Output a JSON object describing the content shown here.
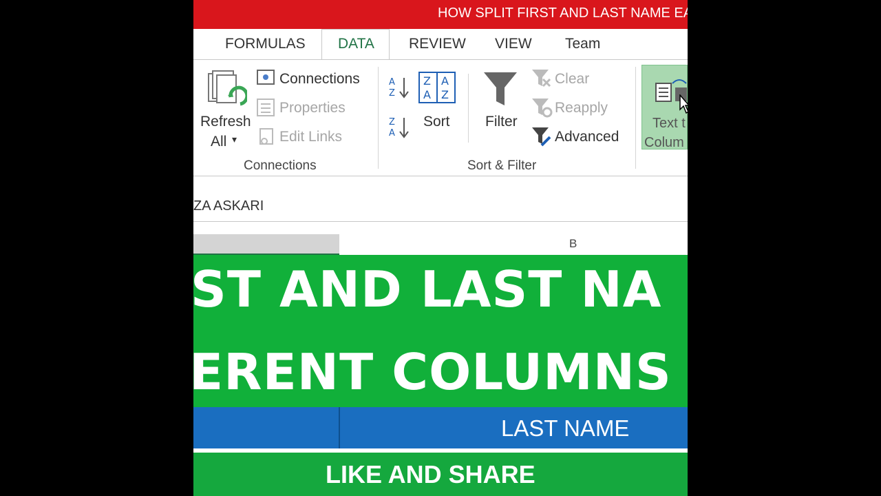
{
  "title_bar": "HOW SPLIT FIRST AND LAST NAME EA",
  "tabs": [
    {
      "label": "FORMULAS"
    },
    {
      "label": "DATA",
      "active": true
    },
    {
      "label": "REVIEW"
    },
    {
      "label": "VIEW"
    },
    {
      "label": "Team"
    }
  ],
  "ribbon": {
    "connections_group": {
      "refresh_label_1": "Refresh",
      "refresh_label_2": "All",
      "connections": "Connections",
      "properties": "Properties",
      "edit_links": "Edit Links",
      "group_label": "Connections"
    },
    "sort_filter_group": {
      "sort": "Sort",
      "filter": "Filter",
      "clear": "Clear",
      "reapply": "Reapply",
      "advanced": "Advanced",
      "group_label": "Sort & Filter"
    },
    "text_to_columns": {
      "label_1": "Text t",
      "label_2": "Colum"
    }
  },
  "formula_bar": {
    "value": "ZA ASKARI"
  },
  "column_header": {
    "b": "B"
  },
  "banner": {
    "line1": "ST AND LAST NA",
    "line2": "ERENT COLUMNS"
  },
  "table_header": {
    "last_name": "LAST NAME"
  },
  "footer": {
    "text": "LIKE AND SHARE"
  },
  "colors": {
    "title_red": "#d9161c",
    "excel_green": "#217346",
    "banner_green": "#11b03a",
    "header_blue": "#1a6ec0"
  }
}
